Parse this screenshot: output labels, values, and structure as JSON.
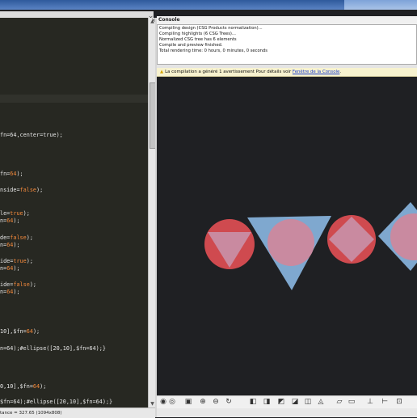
{
  "window": {
    "close_glyph": "×"
  },
  "console": {
    "title": "Console",
    "lines": [
      "Compiling design (CSG Products normalization)...",
      "Compiling highlights (6 CSG Trees)...",
      "Normalized CSG tree has 6 elements",
      "Compile and preview finished.",
      "Total rendering time: 0 hours, 0 minutes, 0 seconds"
    ]
  },
  "warning": {
    "text": "La compilation a généré 1 avertissement Pour détails voir",
    "link": "Fenêtre de la Console",
    "suffix": "."
  },
  "editor": {
    "lines": [
      [
        {
          "t": "fn=64,center=true);"
        }
      ],
      [
        {
          "t": "fn="
        },
        {
          "t": "64",
          "c": "num"
        },
        {
          "t": ");"
        }
      ],
      [
        {
          "t": "nside="
        },
        {
          "t": "false",
          "c": "kw"
        },
        {
          "t": ");"
        }
      ],
      [
        {
          "t": "le="
        },
        {
          "t": "true",
          "c": "kw"
        },
        {
          "t": ");"
        }
      ],
      [
        {
          "t": "n="
        },
        {
          "t": "64",
          "c": "num"
        },
        {
          "t": ");"
        }
      ],
      [
        {
          "t": "de="
        },
        {
          "t": "false",
          "c": "kw"
        },
        {
          "t": ");"
        }
      ],
      [
        {
          "t": "n="
        },
        {
          "t": "64",
          "c": "num"
        },
        {
          "t": ");"
        }
      ],
      [
        {
          "t": "ide="
        },
        {
          "t": "true",
          "c": "kw"
        },
        {
          "t": ");"
        }
      ],
      [
        {
          "t": "n="
        },
        {
          "t": "64",
          "c": "num"
        },
        {
          "t": ");"
        }
      ],
      [
        {
          "t": "ide="
        },
        {
          "t": "false",
          "c": "kw"
        },
        {
          "t": ");"
        }
      ],
      [
        {
          "t": "n="
        },
        {
          "t": "64",
          "c": "num"
        },
        {
          "t": ");"
        }
      ],
      [
        {
          "t": "10],$fn="
        },
        {
          "t": "64",
          "c": "num"
        },
        {
          "t": ");"
        }
      ],
      [
        {
          "t": "n=64);#ellipse([20,10],$fn=64);}"
        }
      ],
      [
        {
          "t": "0,10],$fn="
        },
        {
          "t": "64",
          "c": "num"
        },
        {
          "t": ");"
        }
      ],
      [
        {
          "t": "$fn=64);#ellipse([20,10],$fn=64);}"
        }
      ]
    ]
  },
  "statusbar": {
    "text": "tance = 327.65 (1094x808)"
  },
  "colors": {
    "red": "#cf4a4f",
    "blue": "#7fa8cf",
    "overlap": "#c98aa0",
    "editor_bg": "#272822",
    "viewport_bg": "#1f2023",
    "accent_orange": "#f58a3c"
  },
  "toolbar_icons": [
    "render-icon",
    "preview-icon",
    "zoom-all-icon",
    "zoom-in-icon",
    "zoom-out-icon",
    "reset-view-icon",
    "view-right-icon",
    "view-top-icon",
    "view-bottom-icon",
    "view-left-icon",
    "view-front-icon",
    "view-back-icon",
    "perspective-icon",
    "orthographic-icon",
    "axes-icon",
    "scale-marks-icon",
    "edges-icon"
  ]
}
